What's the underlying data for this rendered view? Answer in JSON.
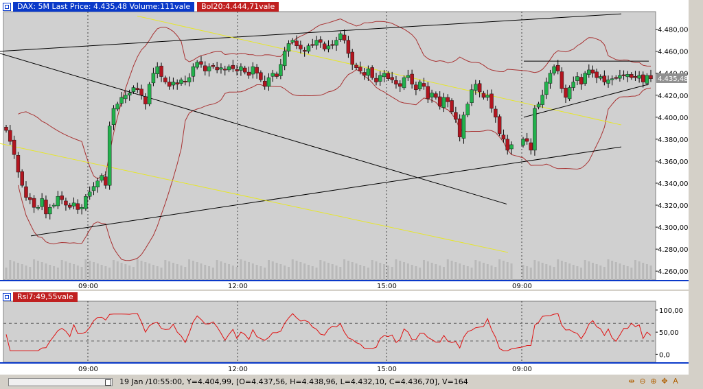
{
  "header": {
    "main_title": "DAX: 5M Last Price: 4.435,48 Volume:111vale",
    "bollinger": "Bol20:4.444,71vale",
    "rsi_title": "Rsi7:49,55vale"
  },
  "price_tag": "4.435,48",
  "status": {
    "text": "19 Jan /10:55:00, Y=4.404,99, [O=4.437,56, H=4.438,96, L=4.432,10, C=4.436,70], V=164",
    "tools": [
      "zoom-fit-icon",
      "zoom-out-icon",
      "zoom-in-icon",
      "pan-icon",
      "auto-scale-icon"
    ]
  },
  "colors": {
    "up": "#22b14c",
    "down": "#b2151f",
    "bollinger": "#a83232",
    "rsi": "#e01010",
    "yellow_trend": "#e6e62a",
    "black_trend": "#000000"
  },
  "chart_data": [
    {
      "type": "candlestick",
      "title": "DAX: 5M",
      "x_ticks": [
        "09:00",
        "12:00",
        "15:00",
        "09:00"
      ],
      "y_ticks": [
        "4.260,00",
        "4.280,00",
        "4.300,00",
        "4.320,00",
        "4.340,00",
        "4.360,00",
        "4.380,00",
        "4.400,00",
        "4.420,00",
        "4.440,00",
        "4.460,00",
        "4.480,00"
      ],
      "ylim": [
        4252,
        4496
      ],
      "last_price": 4435.48,
      "bollinger_period": 20,
      "grid": true,
      "close_series": [
        4388,
        4378,
        4366,
        4350,
        4338,
        4327,
        4325,
        4318,
        4318,
        4326,
        4312,
        4318,
        4320,
        4328,
        4325,
        4320,
        4318,
        4322,
        4316,
        4318,
        4328,
        4332,
        4337,
        4342,
        4347,
        4338,
        4392,
        4408,
        4412,
        4418,
        4420,
        4422,
        4427,
        4425,
        4420,
        4412,
        4430,
        4440,
        4446,
        4437,
        4432,
        4428,
        4432,
        4430,
        4434,
        4432,
        4436,
        4446,
        4450,
        4448,
        4442,
        4446,
        4446,
        4443,
        4445,
        4443,
        4446,
        4444,
        4442,
        4446,
        4441,
        4438,
        4446,
        4440,
        4434,
        4428,
        4436,
        4440,
        4437,
        4448,
        4460,
        4467,
        4470,
        4465,
        4462,
        4460,
        4465,
        4466,
        4470,
        4468,
        4462,
        4465,
        4466,
        4470,
        4476,
        4470,
        4458,
        4448,
        4445,
        4442,
        4438,
        4444,
        4436,
        4432,
        4438,
        4440,
        4435,
        4434,
        4430,
        4428,
        4436,
        4438,
        4430,
        4425,
        4432,
        4428,
        4417,
        4422,
        4418,
        4410,
        4418,
        4414,
        4405,
        4398,
        4382,
        4402,
        4412,
        4425,
        4430,
        4423,
        4418,
        4420,
        4408,
        4400,
        4385,
        4380,
        4370,
        4375,
        4380,
        4378,
        4370,
        4408,
        4412,
        4420,
        4432,
        4440,
        4446,
        4442,
        4426,
        4418,
        4427,
        4432,
        4437,
        4430,
        4440,
        4443,
        4440,
        4436,
        4437,
        4432,
        4434,
        4435,
        4436,
        4438,
        4438,
        4439,
        4436,
        4436,
        4438,
        4432,
        4438,
        4435
      ],
      "trendlines": [
        {
          "color": "black",
          "from": [
            0,
            4458
          ],
          "to": [
            738,
            4321
          ]
        },
        {
          "color": "black",
          "from": [
            0,
            4460
          ],
          "to": [
            905,
            4494
          ]
        },
        {
          "color": "black",
          "from": [
            45,
            4292
          ],
          "to": [
            905,
            4373
          ]
        },
        {
          "color": "yellow",
          "from": [
            0,
            4376
          ],
          "to": [
            740,
            4277
          ]
        },
        {
          "color": "yellow",
          "from": [
            200,
            4492
          ],
          "to": [
            905,
            4393
          ]
        },
        {
          "color": "black",
          "from": [
            763,
            4451
          ],
          "to": [
            945,
            4451
          ]
        },
        {
          "color": "black",
          "from": [
            763,
            4400
          ],
          "to": [
            945,
            4430
          ]
        }
      ]
    },
    {
      "type": "line",
      "title": "Rsi7",
      "x_ticks": [
        "09:00",
        "12:00",
        "15:00",
        "09:00"
      ],
      "y_ticks": [
        "0,0",
        "50,00",
        "100,00"
      ],
      "ylim": [
        -18,
        120
      ],
      "levels": [
        30,
        70
      ],
      "last_value": 49.55
    }
  ]
}
